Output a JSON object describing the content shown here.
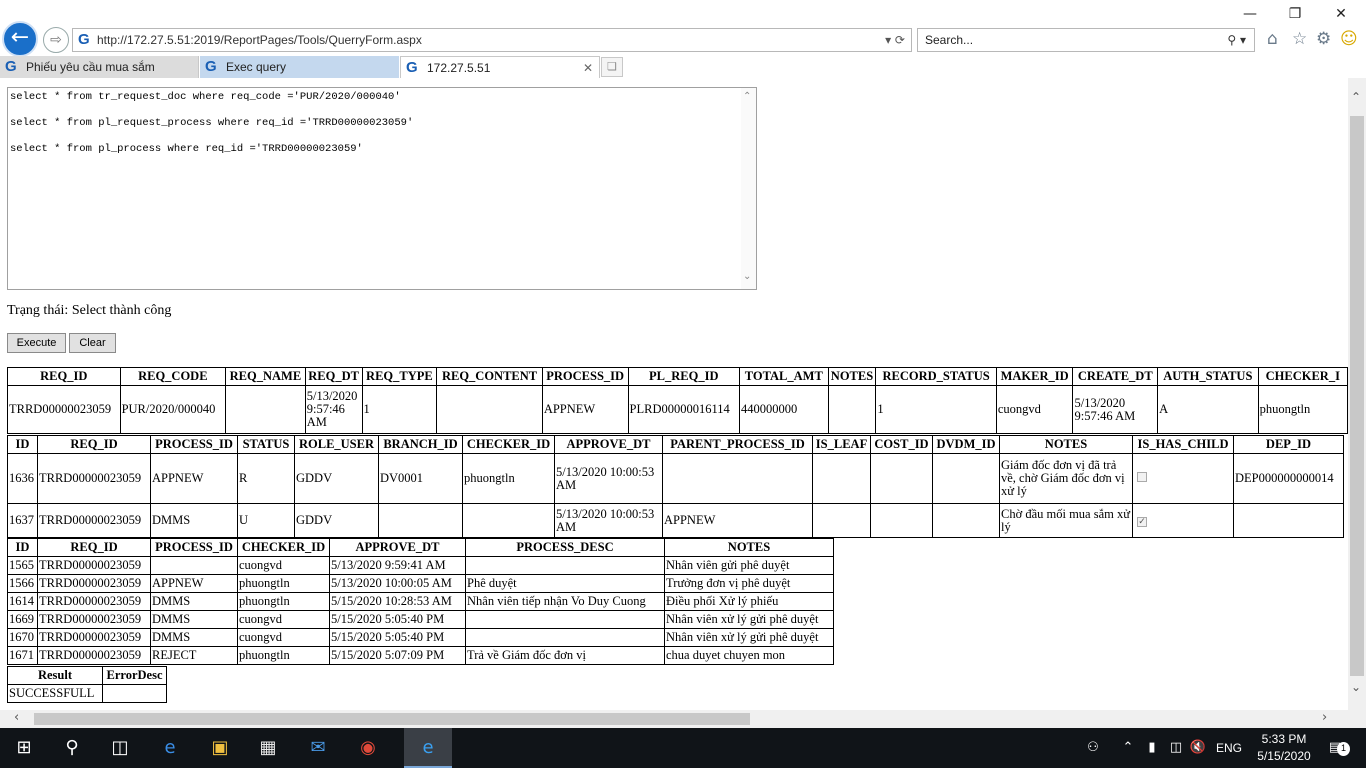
{
  "browser": {
    "url": "http://172.27.5.51:2019/ReportPages/Tools/QuerryForm.aspx",
    "search_placeholder": "Search...",
    "tabs": [
      {
        "label": "Phiếu yêu cầu mua sắm"
      },
      {
        "label": "Exec query"
      },
      {
        "label": "172.27.5.51"
      }
    ]
  },
  "query": {
    "lines": [
      "select * from tr_request_doc where req_code ='PUR/2020/000040'",
      "select * from pl_request_process where req_id ='TRRD00000023059'",
      "select * from pl_process where req_id ='TRRD00000023059'"
    ]
  },
  "status_text": "Trạng thái: Select thành công",
  "buttons": {
    "execute": "Execute",
    "clear": "Clear"
  },
  "table1": {
    "headers": [
      "REQ_ID",
      "REQ_CODE",
      "REQ_NAME",
      "REQ_DT",
      "REQ_TYPE",
      "REQ_CONTENT",
      "PROCESS_ID",
      "PL_REQ_ID",
      "TOTAL_AMT",
      "NOTES",
      "RECORD_STATUS",
      "MAKER_ID",
      "CREATE_DT",
      "AUTH_STATUS",
      "CHECKER_I"
    ],
    "rows": [
      [
        "TRRD00000023059",
        "PUR/2020/000040",
        "",
        "5/13/2020 9:57:46 AM",
        "1",
        "",
        "APPNEW",
        "PLRD00000016114",
        "440000000",
        "",
        "1",
        "cuongvd",
        "5/13/2020 9:57:46 AM",
        "A",
        "phuongtln"
      ]
    ]
  },
  "table2": {
    "headers": [
      "ID",
      "REQ_ID",
      "PROCESS_ID",
      "STATUS",
      "ROLE_USER",
      "BRANCH_ID",
      "CHECKER_ID",
      "APPROVE_DT",
      "PARENT_PROCESS_ID",
      "IS_LEAF",
      "COST_ID",
      "DVDM_ID",
      "NOTES",
      "IS_HAS_CHILD",
      "DEP_ID"
    ],
    "rows": [
      [
        "1636",
        "TRRD00000023059",
        "APPNEW",
        "R",
        "GDDV",
        "DV0001",
        "phuongtln",
        "5/13/2020 10:00:53 AM",
        "",
        "",
        "",
        "",
        "Giám đốc đơn vị đã trả về, chờ Giám đốc đơn vị xử lý",
        "unchecked",
        "DEP000000000014"
      ],
      [
        "1637",
        "TRRD00000023059",
        "DMMS",
        "U",
        "GDDV",
        "",
        "",
        "5/13/2020 10:00:53 AM",
        "APPNEW",
        "",
        "",
        "",
        "Chờ đầu mối mua sắm xử lý",
        "checked",
        ""
      ]
    ]
  },
  "table3": {
    "headers": [
      "ID",
      "REQ_ID",
      "PROCESS_ID",
      "CHECKER_ID",
      "APPROVE_DT",
      "PROCESS_DESC",
      "NOTES"
    ],
    "rows": [
      [
        "1565",
        "TRRD00000023059",
        "",
        "cuongvd",
        "5/13/2020 9:59:41 AM",
        "",
        "Nhân viên gửi phê duyệt"
      ],
      [
        "1566",
        "TRRD00000023059",
        "APPNEW",
        "phuongtln",
        "5/13/2020 10:00:05 AM",
        "Phê duyệt",
        "Trưởng đơn vị phê duyệt"
      ],
      [
        "1614",
        "TRRD00000023059",
        "DMMS",
        "phuongtln",
        "5/15/2020 10:28:53 AM",
        "Nhân viên tiếp nhận Vo Duy Cuong",
        "Điều phối Xử lý phiếu"
      ],
      [
        "1669",
        "TRRD00000023059",
        "DMMS",
        "cuongvd",
        "5/15/2020 5:05:40 PM",
        "",
        "Nhân viên xử lý gửi phê duyệt"
      ],
      [
        "1670",
        "TRRD00000023059",
        "DMMS",
        "cuongvd",
        "5/15/2020 5:05:40 PM",
        "",
        "Nhân viên xử lý gửi phê duyệt"
      ],
      [
        "1671",
        "TRRD00000023059",
        "REJECT",
        "phuongtln",
        "5/15/2020 5:07:09 PM",
        "Trả về Giám đốc đơn vị",
        "chua duyet chuyen mon"
      ]
    ]
  },
  "table4": {
    "headers": [
      "Result",
      "ErrorDesc"
    ],
    "rows": [
      [
        "SUCCESSFULL",
        ""
      ]
    ]
  },
  "taskbar": {
    "language": "ENG",
    "time": "5:33 PM",
    "date": "5/15/2020",
    "notification_count": "1"
  },
  "icons": {
    "back": "back-arrow-icon",
    "forward": "forward-arrow-icon",
    "home": "home-icon",
    "favorites": "star-icon",
    "settings": "gear-icon",
    "feedback": "smiley-icon"
  }
}
